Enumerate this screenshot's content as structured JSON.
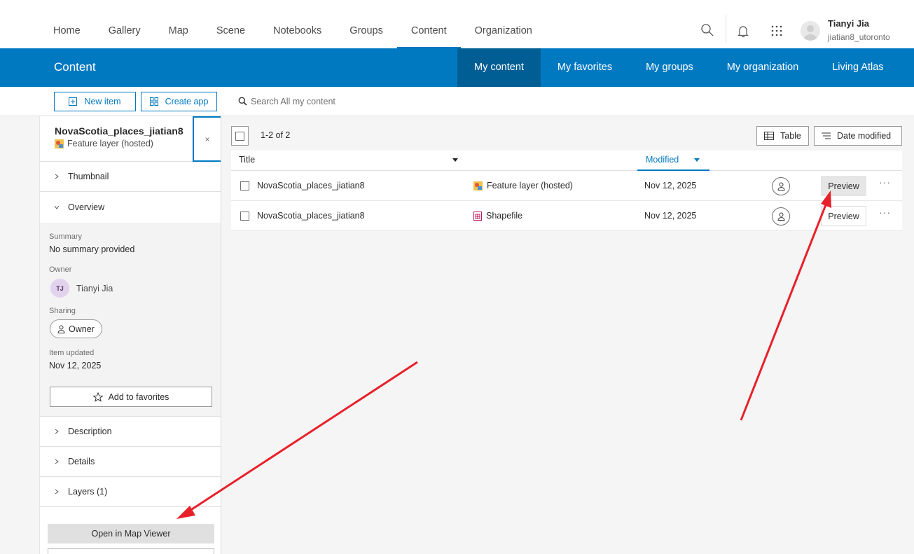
{
  "topnav": {
    "links": [
      "Home",
      "Gallery",
      "Map",
      "Scene",
      "Notebooks",
      "Groups",
      "Content",
      "Organization"
    ],
    "active": "Content",
    "user": {
      "name": "Tianyi Jia",
      "id": "jiatian8_utoronto"
    }
  },
  "bluebar": {
    "title": "Content",
    "tabs": [
      "My content",
      "My favorites",
      "My groups",
      "My organization",
      "Living Atlas"
    ],
    "active_tab": "My content",
    "color": "#0079c1",
    "active_color": "#005e95"
  },
  "actions": {
    "new_item": "New item",
    "create_app": "Create app"
  },
  "search": {
    "placeholder": "Search All my content"
  },
  "panel": {
    "item_name": "NovaScotia_places_jiatian8",
    "item_type": "Feature layer (hosted)",
    "close": "×",
    "sections": {
      "thumbnail": "Thumbnail",
      "overview": "Overview",
      "description": "Description",
      "details": "Details",
      "layers": "Layers (1)"
    },
    "overview": {
      "summary_label": "Summary",
      "summary_value": "No summary provided",
      "owner_label": "Owner",
      "owner_initials": "TJ",
      "owner_name": "Tianyi Jia",
      "sharing_label": "Sharing",
      "sharing_value": "Owner",
      "updated_label": "Item updated",
      "updated_value": "Nov 12, 2025",
      "favorites_button": "Add to favorites"
    },
    "open_button": "Open in Map Viewer"
  },
  "results": {
    "count": "1-2 of 2",
    "view_button": "Table",
    "sort_button": "Date modified",
    "columns": {
      "title": "Title",
      "modified": "Modified"
    },
    "rows": [
      {
        "title": "NovaScotia_places_jiatian8",
        "type": "Feature layer (hosted)",
        "type_icon": "feature-layer-icon",
        "modified": "Nov 12, 2025",
        "preview": "Preview",
        "more": "···"
      },
      {
        "title": "NovaScotia_places_jiatian8",
        "type": "Shapefile",
        "type_icon": "shapefile-icon",
        "modified": "Nov 12, 2025",
        "preview": "Preview",
        "more": "···"
      }
    ]
  },
  "annotations": {
    "arrow_color": "#e8202a"
  }
}
